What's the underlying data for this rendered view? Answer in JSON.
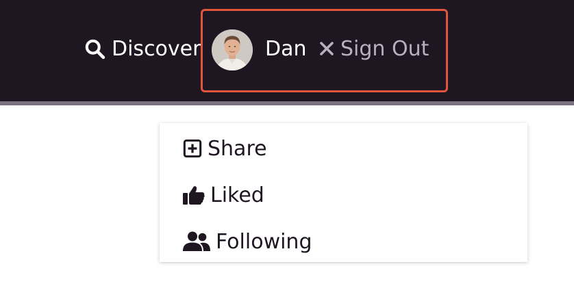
{
  "nav": {
    "discover_label": "Discover",
    "discover_icon": "search-icon",
    "user_name": "Dan",
    "signout_label": "Sign Out",
    "signout_icon": "close-icon"
  },
  "dropdown": {
    "items": [
      {
        "label": "Share",
        "icon": "plus-square-icon"
      },
      {
        "label": "Liked",
        "icon": "thumbs-up-icon"
      },
      {
        "label": "Following",
        "icon": "users-icon"
      }
    ]
  },
  "colors": {
    "navbar_bg": "#1e1620",
    "highlight_border": "#e0553c",
    "signout_text": "#b8afc0",
    "navbar_border": "#7a727e"
  }
}
